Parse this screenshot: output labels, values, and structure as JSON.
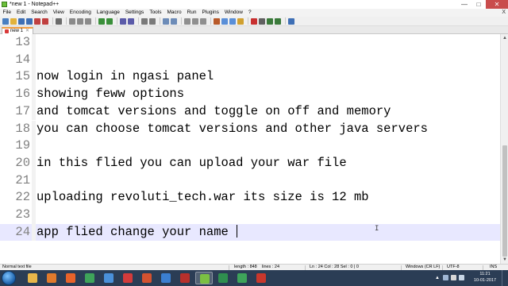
{
  "window": {
    "title": "*new 1 - Notepad++",
    "controls": {
      "minimize": "—",
      "maximize": "□",
      "close": "✕"
    }
  },
  "menu": {
    "items": [
      "File",
      "Edit",
      "Search",
      "View",
      "Encoding",
      "Language",
      "Settings",
      "Tools",
      "Macro",
      "Run",
      "Plugins",
      "Window",
      "?"
    ],
    "close_glyph": "X"
  },
  "toolbar": {
    "icons": [
      "new-file-icon",
      "open-file-icon",
      "save-icon",
      "save-all-icon",
      "close-icon",
      "close-all-icon",
      "print-icon",
      "cut-icon",
      "copy-icon",
      "paste-icon",
      "undo-icon",
      "redo-icon",
      "find-icon",
      "replace-icon",
      "zoom-in-icon",
      "zoom-out-icon",
      "sync-vertical-icon",
      "sync-horizontal-icon",
      "word-wrap-icon",
      "show-all-chars-icon",
      "indent-guide-icon",
      "user-lang-icon",
      "doc-map-icon",
      "function-list-icon",
      "folder-workspace-icon",
      "record-macro-icon",
      "stop-macro-icon",
      "play-macro-icon",
      "run-macro-icon",
      "save-macro-icon"
    ]
  },
  "tabs": [
    {
      "label": "new 1",
      "close": "✕",
      "modified": true
    }
  ],
  "editor": {
    "lines": [
      {
        "number": "13",
        "text": ""
      },
      {
        "number": "14",
        "text": ""
      },
      {
        "number": "15",
        "text": "now login in ngasi panel"
      },
      {
        "number": "16",
        "text": "showing feww options"
      },
      {
        "number": "17",
        "text": "and tomcat versions and toggle on off and memory"
      },
      {
        "number": "18",
        "text": "you can choose tomcat versions and other java servers"
      },
      {
        "number": "19",
        "text": ""
      },
      {
        "number": "20",
        "text": "in this flied you can upload your war file"
      },
      {
        "number": "21",
        "text": ""
      },
      {
        "number": "22",
        "text": "uploading revoluti_tech.war its size is 12 mb"
      },
      {
        "number": "23",
        "text": ""
      },
      {
        "number": "24",
        "text": "app flied change your name "
      }
    ],
    "current_line": "24",
    "mouse_cursor": "I"
  },
  "scrollbar": {
    "up": "▲",
    "down": "▼"
  },
  "status": {
    "file_type": "Normal text file",
    "length": "length : 848",
    "lines": "lines : 24",
    "position": "Ln : 24    Col : 28    Sel : 0 | 0",
    "eol": "Windows (CR LF)",
    "encoding": "UTF-8",
    "mode": "INS"
  },
  "taskbar": {
    "apps": [
      "explorer-icon",
      "media-player-icon",
      "firefox-icon",
      "chrome-icon",
      "browser-icon",
      "snagit-icon",
      "powerpoint-icon",
      "globe-icon",
      "filezilla-icon",
      "notepadpp-icon",
      "download-icon",
      "chrome-icon-2",
      "recorder-icon"
    ],
    "app_colors": [
      "#e8b64a",
      "#e07a2c",
      "#e8632a",
      "#3ea45a",
      "#4a90d9",
      "#d33b3b",
      "#d35230",
      "#3b7fd1",
      "#b8302c",
      "#7bc043",
      "#2f8f4f",
      "#3ea45a",
      "#c9372c"
    ],
    "active_app": 9,
    "tray": {
      "arrow": "▲"
    },
    "clock": {
      "time": "11:21",
      "date": "10-01-2017"
    }
  }
}
